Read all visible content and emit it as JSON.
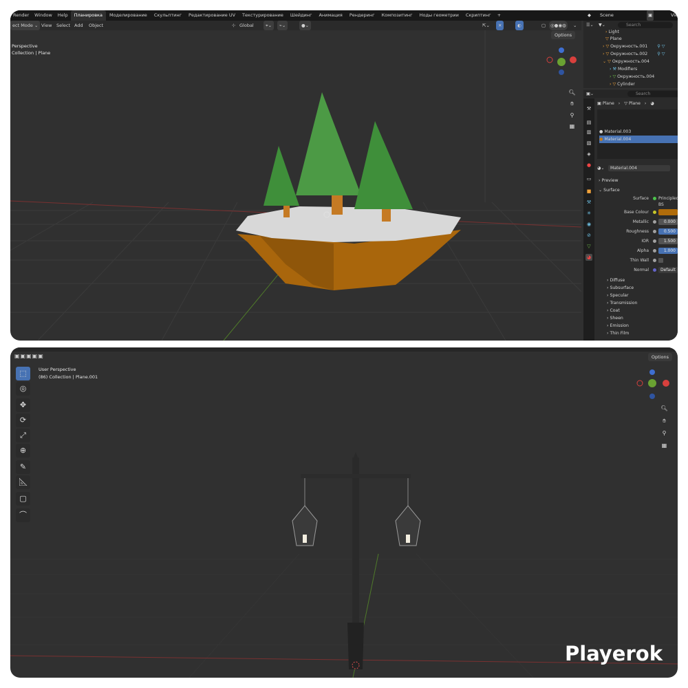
{
  "top": {
    "menu": [
      "Render",
      "Window",
      "Help"
    ],
    "workspaces": [
      "Планировка",
      "Моделирование",
      "Скульптинг",
      "Редактирование UV",
      "Текстурирование",
      "Шейдинг",
      "Анимация",
      "Рендеринг",
      "Композитинг",
      "Ноды геометрии",
      "Скриптинг"
    ],
    "add_tab": "+",
    "header": {
      "mode": "ect Mode",
      "view": "View",
      "select": "Select",
      "add": "Add",
      "object": "Object",
      "transform": "Global"
    },
    "viewport": {
      "line1": "Perspective",
      "line2": "Collection | Plane",
      "options": "Options"
    },
    "nav": {
      "z": "Z",
      "x": "X"
    },
    "outliner": {
      "scene": "Scene",
      "view_layer": "Vie",
      "search_placeholder": "Search",
      "items": [
        "Light",
        "Plane",
        "Окружность.001",
        "Окружность.002",
        "Окружность.004",
        "Modifiers",
        "Окружность.004",
        "Cylinder"
      ]
    },
    "properties": {
      "search_placeholder": "Search",
      "breadcrumb": [
        "Plane",
        "Plane"
      ],
      "materials": [
        "Material.003",
        "Material.004"
      ],
      "material_name": "Material.004",
      "section_preview": "Preview",
      "section_surface": "Surface",
      "surface_label": "Surface",
      "surface_value": "Principled BS",
      "rows": [
        {
          "label": "Base Colour",
          "value": ""
        },
        {
          "label": "Metallic",
          "value": "0.000"
        },
        {
          "label": "Roughness",
          "value": "0.500"
        },
        {
          "label": "IOR",
          "value": "1.500"
        },
        {
          "label": "Alpha",
          "value": "1.000"
        },
        {
          "label": "Thin Wall",
          "value": ""
        },
        {
          "label": "Normal",
          "value": "Default"
        }
      ],
      "subsections": [
        "Diffuse",
        "Subsurface",
        "Specular",
        "Transmission",
        "Coat",
        "Sheen",
        "Emission",
        "Thin Film"
      ]
    }
  },
  "bottom": {
    "viewport": {
      "line1": "User Perspective",
      "line2": "(86) Collection | Plane.001",
      "options": "Options"
    },
    "nav": {
      "z": "Z",
      "x": "X"
    }
  },
  "watermark": "Playerok",
  "colors": {
    "accent": "#4772b3",
    "base_colour": "#b06c0a",
    "background": "#303030"
  }
}
